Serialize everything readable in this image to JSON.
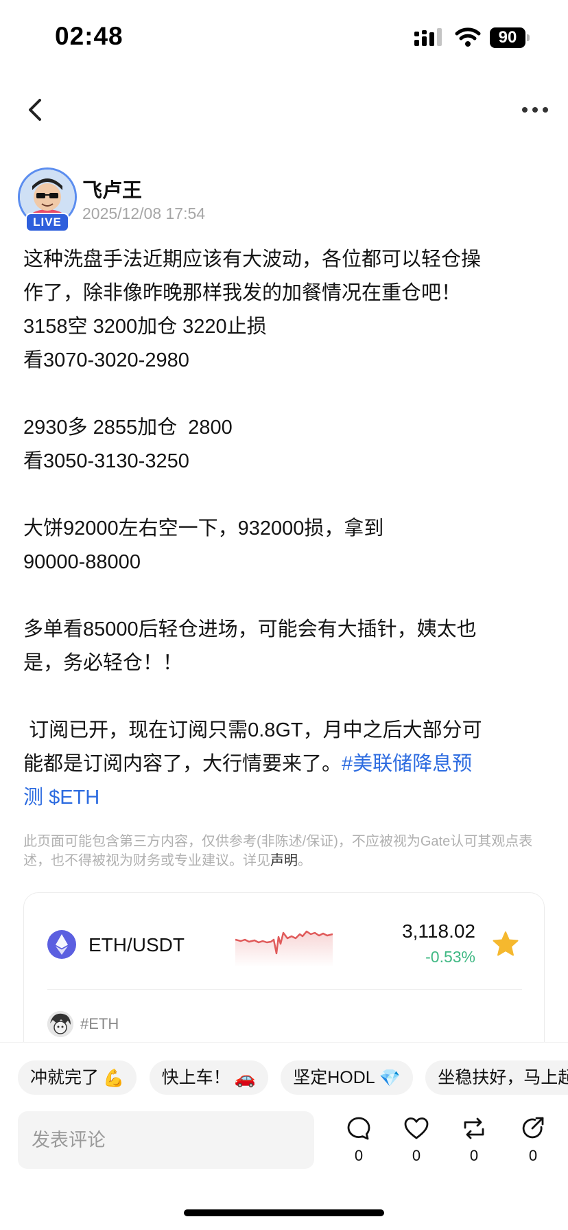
{
  "status_bar": {
    "time": "02:48",
    "battery": "90",
    "icons": [
      "signal-icon",
      "wifi-icon",
      "battery-icon"
    ]
  },
  "nav": {
    "back_icon": "chevron-left-icon",
    "more_icon": "more-horizontal-icon"
  },
  "author": {
    "name": "飞卢王",
    "date": "2025/12/08 17:54",
    "live_badge": "LIVE"
  },
  "post": {
    "lines": [
      "这种洗盘手法近期应该有大波动，各位都可以轻仓操",
      "作了，除非像昨晚那样我发的加餐情况在重仓吧！",
      "3158空 3200加仓 3220止损",
      "看3070-3020-2980",
      "",
      "2930多 2855加仓  2800",
      "看3050-3130-3250",
      "",
      "大饼92000左右空一下，932000损，拿到",
      "90000-88000",
      "",
      "多单看85000后轻仓进场，可能会有大插针，姨太也",
      "是，务必轻仓！！",
      "",
      " 订阅已开，现在订阅只需0.8GT，月中之后大部分可",
      "能都是订阅内容了，大行情要来了。"
    ],
    "hashtag_part1": "#美联储降息预",
    "hashtag_part2": "测",
    "cashtag": "$ETH"
  },
  "disclaimer": {
    "text": "此页面可能包含第三方内容，仅供参考(非陈述/保证)，不应被视为Gate认可其观点表述，也不得被视为财务或专业建议。详见",
    "link": "声明",
    "end": "。"
  },
  "market_card": {
    "pair": "ETH/USDT",
    "price": "3,118.02",
    "change": "-0.53%",
    "tag": "#ETH",
    "colors": {
      "eth": "#5b5fe0",
      "negative_line": "#e05a5a",
      "change_text": "#3fb883",
      "star": "#f5b82e"
    }
  },
  "quick_replies": [
    {
      "label": "冲就完了",
      "emoji": "💪"
    },
    {
      "label": "快上车！",
      "emoji": "🚗"
    },
    {
      "label": "坚定HODL",
      "emoji": "💎"
    },
    {
      "label": "坐稳扶好，马上起飞",
      "emoji": ""
    }
  ],
  "comment": {
    "placeholder": "发表评论"
  },
  "actions": {
    "comments": "0",
    "likes": "0",
    "reposts": "0",
    "shares": "0"
  },
  "colors": {
    "link": "#2c6be0",
    "live_badge": "#2e5fdc"
  }
}
